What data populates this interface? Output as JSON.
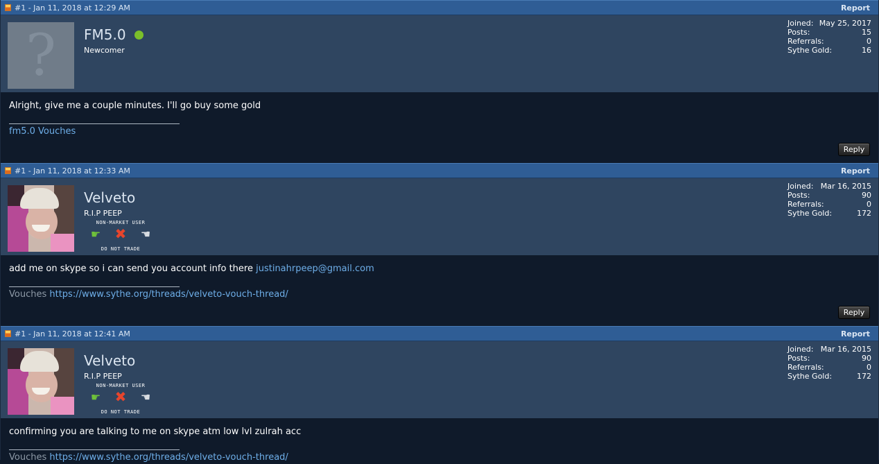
{
  "posts": [
    {
      "date": "#1 - Jan 11, 2018 at 12:29 AM",
      "report_label": "Report",
      "username": "FM5.0",
      "online": true,
      "user_title": "Newcomer",
      "avatar": "default-question-mark",
      "stats": {
        "joined_label": "Joined:",
        "joined": "May 25, 2017",
        "posts_label": "Posts:",
        "posts": "15",
        "referrals_label": "Referrals:",
        "referrals": "0",
        "gold_label": "Sythe Gold:",
        "gold": "16"
      },
      "message": "Alright, give me a couple minutes. I'll go buy some gold",
      "signature": {
        "prefix": "",
        "link": "fm5.0 Vouches"
      },
      "reply_label": "Reply"
    },
    {
      "date": "#1 - Jan 11, 2018 at 12:33 AM",
      "report_label": "Report",
      "username": "Velveto",
      "user_title": "R.I.P PEEP",
      "avatar": "photo",
      "badge": {
        "top": "NON-MARKET USER",
        "bottom": "DO NOT TRADE"
      },
      "stats": {
        "joined_label": "Joined:",
        "joined": "Mar 16, 2015",
        "posts_label": "Posts:",
        "posts": "90",
        "referrals_label": "Referrals:",
        "referrals": "0",
        "gold_label": "Sythe Gold:",
        "gold": "172"
      },
      "message": "add me on skype so i can send you account info there ",
      "message_link": "justinahrpeep@gmail.com",
      "signature": {
        "prefix": "Vouches ",
        "link": "https://www.sythe.org/threads/velveto-vouch-thread/"
      },
      "reply_label": "Reply"
    },
    {
      "date": "#1 - Jan 11, 2018 at 12:41 AM",
      "report_label": "Report",
      "username": "Velveto",
      "user_title": "R.I.P PEEP",
      "avatar": "photo",
      "badge": {
        "top": "NON-MARKET USER",
        "bottom": "DO NOT TRADE"
      },
      "stats": {
        "joined_label": "Joined:",
        "joined": "Mar 16, 2015",
        "posts_label": "Posts:",
        "posts": "90",
        "referrals_label": "Referrals:",
        "referrals": "0",
        "gold_label": "Sythe Gold:",
        "gold": "172"
      },
      "message": "confirming you are talking to me on skype atm low lvl zulrah acc",
      "signature": {
        "prefix": "Vouches ",
        "link": "https://www.sythe.org/threads/velveto-vouch-thread/"
      }
    }
  ],
  "colors": {
    "header_bg": "#2f5d95",
    "userbar_bg": "#2f4560",
    "body_bg": "#0f1a2a",
    "link": "#6eaee8",
    "online": "#7bbf2a"
  }
}
